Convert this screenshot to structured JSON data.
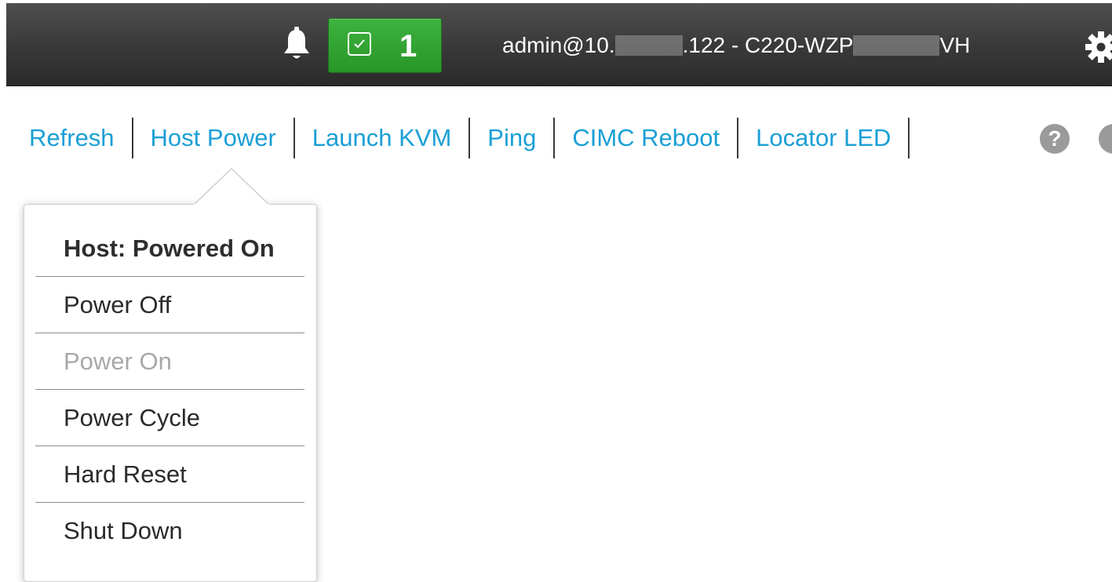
{
  "header": {
    "notification_count": "1",
    "user_prefix": "admin@10.",
    "user_middle": ".122 - C220-WZP",
    "user_suffix": "VH"
  },
  "toolbar": {
    "items": [
      {
        "label": "Refresh"
      },
      {
        "label": "Host Power"
      },
      {
        "label": "Launch KVM"
      },
      {
        "label": "Ping"
      },
      {
        "label": "CIMC Reboot"
      },
      {
        "label": "Locator LED"
      }
    ],
    "help_glyph": "?"
  },
  "host_power_menu": {
    "status": "Host: Powered On",
    "items": [
      {
        "label": "Power Off",
        "enabled": true
      },
      {
        "label": "Power On",
        "enabled": false
      },
      {
        "label": "Power Cycle",
        "enabled": true
      },
      {
        "label": "Hard Reset",
        "enabled": true
      },
      {
        "label": "Shut Down",
        "enabled": true
      }
    ]
  },
  "colors": {
    "header_bg": "#3a3a3a",
    "badge_green": "#2f9f2f",
    "link_blue": "#1a9fd6",
    "disabled_text": "#a8a8a8"
  },
  "icons": [
    "bell-icon",
    "check-icon",
    "gear-icon",
    "help-icon",
    "info-icon"
  ]
}
